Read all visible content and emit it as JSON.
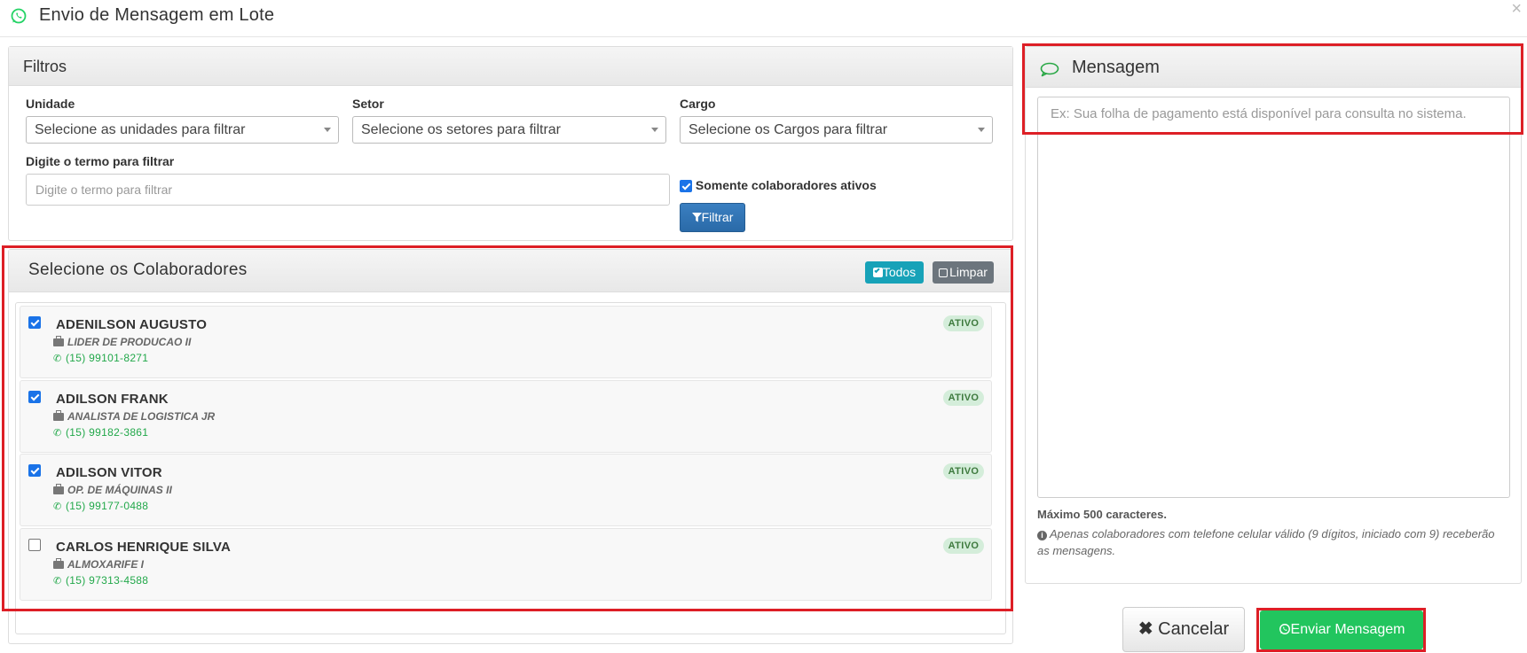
{
  "modal": {
    "title": "Envio de Mensagem em Lote",
    "close_icon": "×"
  },
  "filtros": {
    "title": "Filtros",
    "unidade": {
      "label": "Unidade",
      "value": "Selecione as unidades para filtrar"
    },
    "setor": {
      "label": "Setor",
      "value": "Selecione os setores para filtrar"
    },
    "cargo": {
      "label": "Cargo",
      "value": "Selecione os Cargos para filtrar"
    },
    "termo": {
      "label": "Digite o termo para filtrar",
      "placeholder": "Digite o termo para filtrar"
    },
    "somente_ativos": {
      "label": "Somente colaboradores ativos",
      "checked": true
    },
    "filtrar_button": "Filtrar"
  },
  "colaboradores": {
    "title": "Selecione os Colaboradores",
    "todos_button": "Todos",
    "limpar_button": "Limpar",
    "items": [
      {
        "name": "ADENILSON AUGUSTO",
        "role": "LIDER DE PRODUCAO II",
        "phone": "(15) 99101-8271",
        "status": "ATIVO",
        "checked": true
      },
      {
        "name": "ADILSON FRANK",
        "role": "ANALISTA DE LOGISTICA JR",
        "phone": "(15) 99182-3861",
        "status": "ATIVO",
        "checked": true
      },
      {
        "name": "ADILSON VITOR",
        "role": "OP. DE MÁQUINAS II",
        "phone": "(15) 99177-0488",
        "status": "ATIVO",
        "checked": true
      },
      {
        "name": "CARLOS HENRIQUE SILVA",
        "role": "ALMOXARIFE I",
        "phone": "(15) 97313-4588",
        "status": "ATIVO",
        "checked": false
      }
    ]
  },
  "mensagem": {
    "title": "Mensagem",
    "placeholder": "Ex: Sua folha de pagamento está disponível para consulta no sistema.",
    "max_chars": "Máximo 500 caracteres.",
    "info": "Apenas colaboradores com telefone celular válido (9 dígitos, iniciado com 9) receberão as mensagens."
  },
  "footer": {
    "cancel_button": "Cancelar",
    "send_button": "Enviar Mensagem"
  },
  "colors": {
    "whatsapp_green": "#25d366",
    "highlight_red": "#dd1f26",
    "primary_blue": "#2a6aa8",
    "info_teal": "#17a2b8",
    "send_green": "#22c55e"
  },
  "icons": {
    "header": "whatsapp-icon",
    "message": "chat-bubble-icon",
    "filter": "filter-icon",
    "role": "briefcase-icon",
    "phone": "phone-icon",
    "info": "info-circle-icon",
    "cancel": "times-icon"
  }
}
